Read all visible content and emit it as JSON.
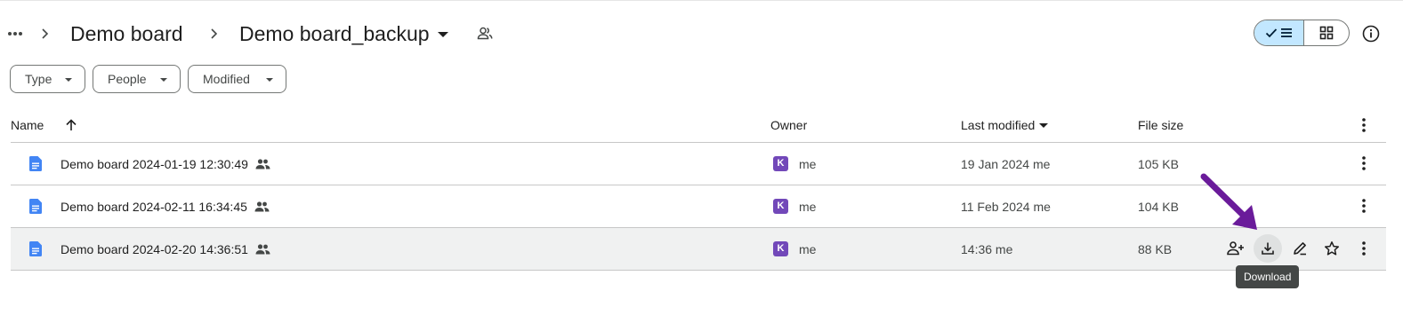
{
  "breadcrumb": {
    "items": [
      "Demo board",
      "Demo board_backup"
    ]
  },
  "filters": {
    "type_label": "Type",
    "people_label": "People",
    "modified_label": "Modified"
  },
  "table": {
    "headers": {
      "name": "Name",
      "owner": "Owner",
      "last_modified": "Last modified",
      "file_size": "File size"
    },
    "rows": [
      {
        "name": "Demo board 2024-01-19 12:30:49",
        "owner_initial": "K",
        "owner": "me",
        "modified": "19 Jan 2024 me",
        "size": "105 KB"
      },
      {
        "name": "Demo board 2024-02-11 16:34:45",
        "owner_initial": "K",
        "owner": "me",
        "modified": "11 Feb 2024 me",
        "size": "104 KB"
      },
      {
        "name": "Demo board 2024-02-20 14:36:51",
        "owner_initial": "K",
        "owner": "me",
        "modified": "14:36 me",
        "size": "88 KB"
      }
    ]
  },
  "tooltip": {
    "text": "Download"
  },
  "colors": {
    "accent": "#0b57d0",
    "doc_icon": "#4285f4",
    "avatar": "#7248b9",
    "view_toggle_selected": "#c2e7ff",
    "annotation_arrow": "#6a1b9a",
    "tooltip_bg": "#444746"
  },
  "icons": {
    "breadcrumb_more": "more-horiz-icon",
    "breadcrumb_separator": "chevron-right-icon",
    "shared_folder": "people-outline-icon",
    "list_view": "check-list-icon",
    "grid_view": "grid-icon",
    "info": "info-icon",
    "sort": "arrow-up-icon",
    "file": "google-docs-icon",
    "shared_file": "people-icon",
    "row_actions": [
      "share-person-add-icon",
      "download-icon",
      "rename-pencil-icon",
      "star-outline-icon",
      "more-vert-icon"
    ]
  }
}
